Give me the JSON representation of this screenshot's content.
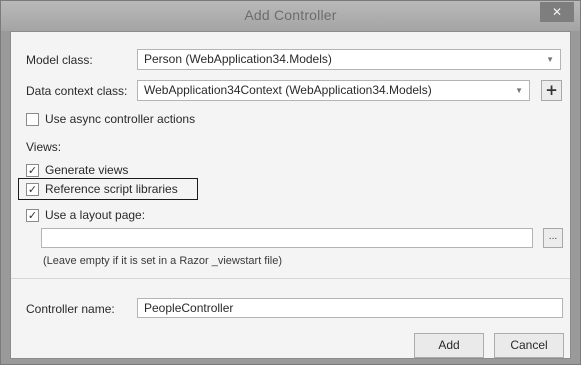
{
  "window": {
    "title": "Add Controller",
    "close_glyph": "✕"
  },
  "form": {
    "model_class_label": "Model class:",
    "model_class_value": "Person (WebApplication34.Models)",
    "data_context_label": "Data context class:",
    "data_context_value": "WebApplication34Context (WebApplication34.Models)",
    "add_context_glyph": "+",
    "async_label": "Use async controller actions",
    "async_checked": false,
    "views_label": "Views:",
    "generate_views_label": "Generate views",
    "generate_views_checked": true,
    "reference_scripts_label": "Reference script libraries",
    "reference_scripts_checked": true,
    "layout_page_label": "Use a layout page:",
    "layout_page_checked": true,
    "layout_page_value": "",
    "browse_glyph": "...",
    "layout_hint": "(Leave empty if it is set in a Razor _viewstart file)",
    "controller_name_label": "Controller name:",
    "controller_name_value": "PeopleController"
  },
  "buttons": {
    "add": "Add",
    "cancel": "Cancel"
  },
  "icons": {
    "combo_arrow": "chevron-down-icon",
    "check": "checkmark-icon",
    "close": "close-icon"
  },
  "check_glyph": "✓",
  "arrow_glyph": "▼"
}
